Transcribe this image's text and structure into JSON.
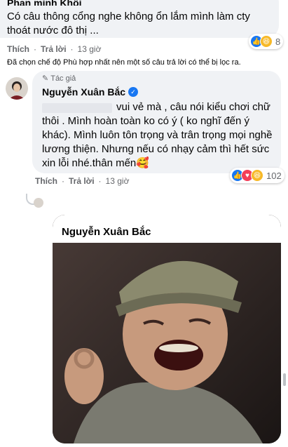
{
  "comment1": {
    "author_cut": "Phan minh Khôi",
    "text": "Có câu thông cổng nghe không ổn lắm mình làm cty thoát nước đô thị ...",
    "reaction_count": "8",
    "reactions": [
      "like-icon",
      "haha-icon"
    ],
    "actions": {
      "like": "Thích",
      "reply": "Trả lời",
      "dot": "·",
      "time": "13 giờ"
    }
  },
  "filter_note": "Đã chọn chế độ Phù hợp nhất nên một số câu trả lời có thể bị lọc ra.",
  "comment2": {
    "tag": "Tác giả",
    "author": "Nguyễn Xuân Bắc",
    "text": "vui vẻ mà , câu nói kiểu chơi chữ thôi . Mình hoàn toàn ko có ý ( ko nghĩ đến ý khác). Mình luôn tôn trọng và trân trọng mọi nghề lương thiện. Nhưng nếu có nhạy cảm thì hết sức xin lỗi nhé.thân mến🥰",
    "reaction_count": "102",
    "reactions": [
      "like-icon",
      "love-icon",
      "haha-icon"
    ],
    "actions": {
      "like": "Thích",
      "reply": "Trả lời",
      "dot": "·",
      "time": "13 giờ"
    }
  },
  "reply_photo": {
    "author": "Nguyễn Xuân Bắc"
  },
  "colors": {
    "bubble": "#f0f2f5",
    "like_blue": "#1877f2",
    "meta_gray": "#65676b"
  }
}
